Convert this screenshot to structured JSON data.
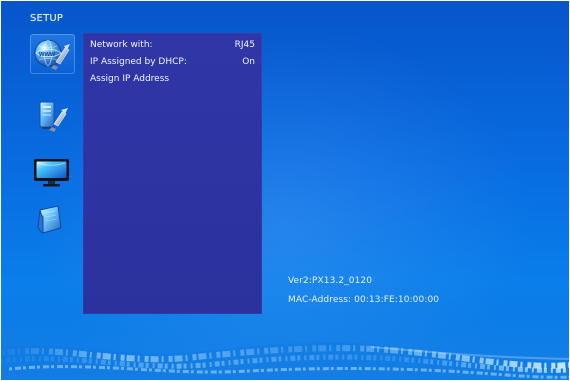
{
  "setup": {
    "title": "SETUP"
  },
  "sidebar": {
    "items": [
      {
        "icon": "globe-wrench-icon",
        "selected": true
      },
      {
        "icon": "computer-wrench-icon",
        "selected": false
      },
      {
        "icon": "monitor-icon",
        "selected": false
      },
      {
        "icon": "book-icon",
        "selected": false
      }
    ]
  },
  "network_menu": {
    "rows": [
      {
        "label": "Network with:",
        "value": "RJ45"
      },
      {
        "label": "IP Assigned by DHCP:",
        "value": "On"
      },
      {
        "label": "Assign IP Address",
        "value": ""
      }
    ]
  },
  "system_info": {
    "version": "Ver2:PX13.2_0120",
    "mac_address": "MAC-Address: 00:13:FE:10:00:00"
  },
  "colors": {
    "background": "#086de2",
    "panel": "#2e33a2",
    "text": "#f2f6ff"
  }
}
